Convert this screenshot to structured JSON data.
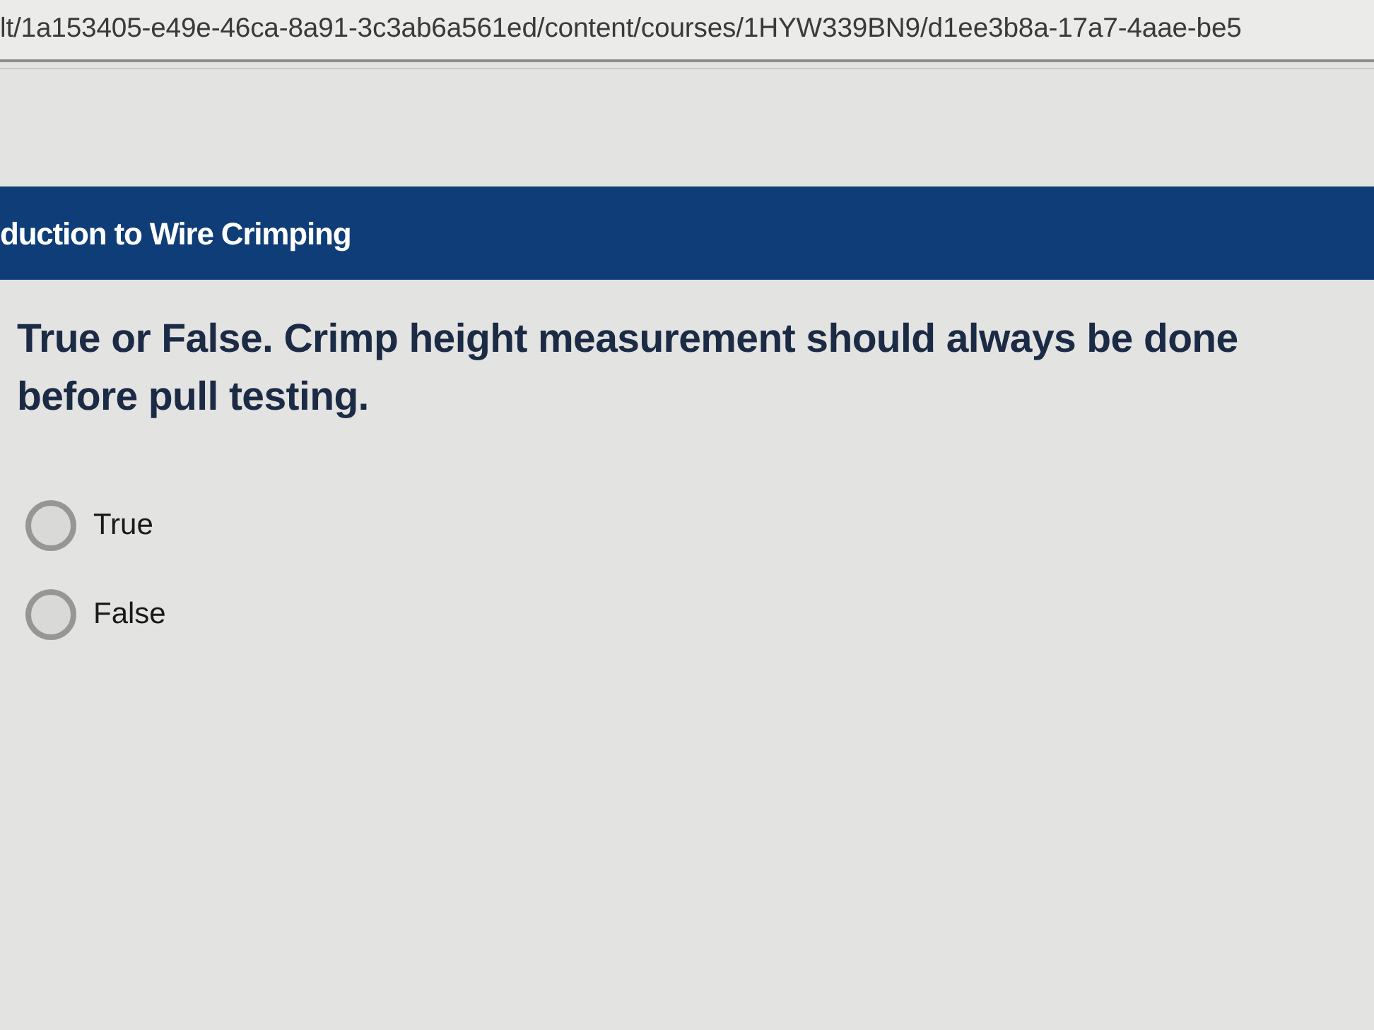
{
  "address_bar": {
    "url": "lt/1a153405-e49e-46ca-8a91-3c3ab6a561ed/content/courses/1HYW339BN9/d1ee3b8a-17a7-4aae-be5"
  },
  "course_header": {
    "title": "duction to Wire Crimping"
  },
  "question": {
    "text": "True or False. Crimp height measurement should always be done before pull testing.",
    "options": [
      {
        "label": "True",
        "selected": false
      },
      {
        "label": "False",
        "selected": false
      }
    ]
  }
}
